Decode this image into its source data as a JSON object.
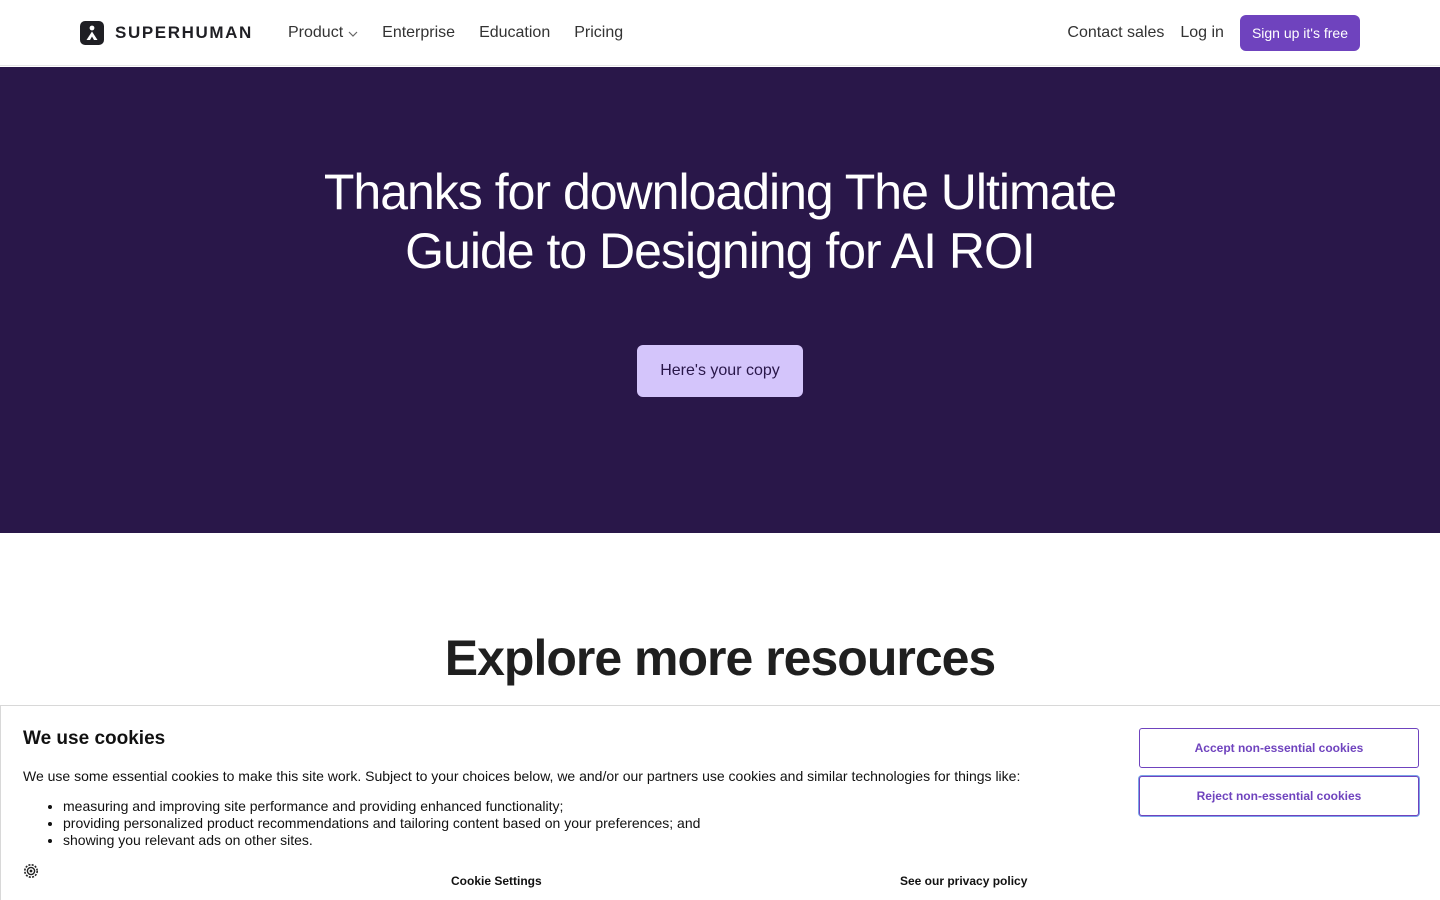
{
  "nav": {
    "brand": "SUPERHUMAN",
    "links": [
      {
        "label": "Product",
        "has_dropdown": true
      },
      {
        "label": "Enterprise"
      },
      {
        "label": "Education"
      },
      {
        "label": "Pricing"
      }
    ],
    "contact_sales": "Contact sales",
    "login": "Log in",
    "signup": "Sign up it's free"
  },
  "hero": {
    "title_line1": "Thanks for downloading The Ultimate",
    "title_line2": "Guide to Designing for AI ROI",
    "button": "Here's your copy"
  },
  "resources": {
    "title": "Explore more resources"
  },
  "cookie_banner": {
    "title": "We use cookies",
    "description": "We use some essential cookies to make this site work. Subject to your choices below, we and/or our partners use cookies and similar technologies for things like:",
    "items": [
      "measuring and improving site performance and providing enhanced functionality;",
      "providing personalized product recommendations and tailoring content based on your preferences; and",
      "showing you relevant ads on other sites."
    ],
    "accept": "Accept non-essential cookies",
    "reject": "Reject non-essential cookies",
    "settings": "Cookie Settings",
    "privacy": "See our privacy policy"
  },
  "colors": {
    "hero_bg": "#291749",
    "accent": "#6f43be",
    "hero_button": "#d4c5fb"
  }
}
